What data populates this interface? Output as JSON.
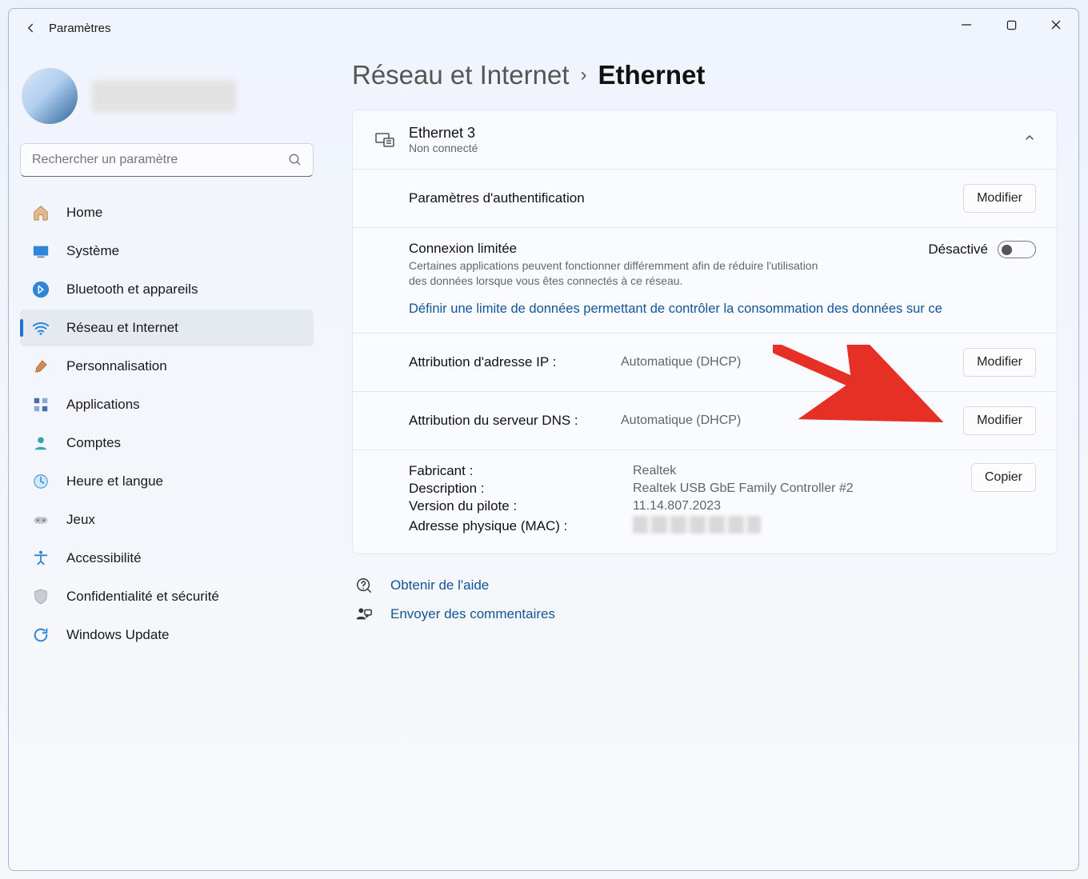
{
  "titlebar": {
    "title": "Paramètres"
  },
  "search": {
    "placeholder": "Rechercher un paramètre"
  },
  "nav": {
    "items": [
      {
        "label": "Home"
      },
      {
        "label": "Système"
      },
      {
        "label": "Bluetooth et appareils"
      },
      {
        "label": "Réseau et Internet",
        "selected": true
      },
      {
        "label": "Personnalisation"
      },
      {
        "label": "Applications"
      },
      {
        "label": "Comptes"
      },
      {
        "label": "Heure et langue"
      },
      {
        "label": "Jeux"
      },
      {
        "label": "Accessibilité"
      },
      {
        "label": "Confidentialité et sécurité"
      },
      {
        "label": "Windows Update"
      }
    ]
  },
  "breadcrumb": {
    "parent": "Réseau et Internet",
    "sep": "›",
    "current": "Ethernet"
  },
  "ethernet": {
    "name": "Ethernet 3",
    "status": "Non connecté",
    "auth": {
      "label": "Paramètres d'authentification",
      "button": "Modifier"
    },
    "metered": {
      "title": "Connexion limitée",
      "desc": "Certaines applications peuvent fonctionner différemment afin de réduire l'utilisation des données lorsque vous êtes connectés à ce réseau.",
      "state": "Désactivé"
    },
    "datalimit_link": "Définir une limite de données permettant de contrôler la consommation des données sur ce",
    "ip": {
      "label": "Attribution d'adresse IP :",
      "value": "Automatique (DHCP)",
      "button": "Modifier"
    },
    "dns": {
      "label": "Attribution du serveur DNS :",
      "value": "Automatique (DHCP)",
      "button": "Modifier"
    },
    "props": {
      "maker_k": "Fabricant :",
      "maker_v": "Realtek",
      "desc_k": "Description :",
      "desc_v": "Realtek USB GbE Family Controller #2",
      "drv_k": "Version du pilote :",
      "drv_v": "11.14.807.2023",
      "mac_k": "Adresse physique (MAC) :",
      "copy": "Copier"
    }
  },
  "footer": {
    "help": "Obtenir de l'aide",
    "feedback": "Envoyer des commentaires"
  },
  "colors": {
    "accent": "#1f72cf",
    "link": "#125596",
    "arrow": "#e63025"
  }
}
